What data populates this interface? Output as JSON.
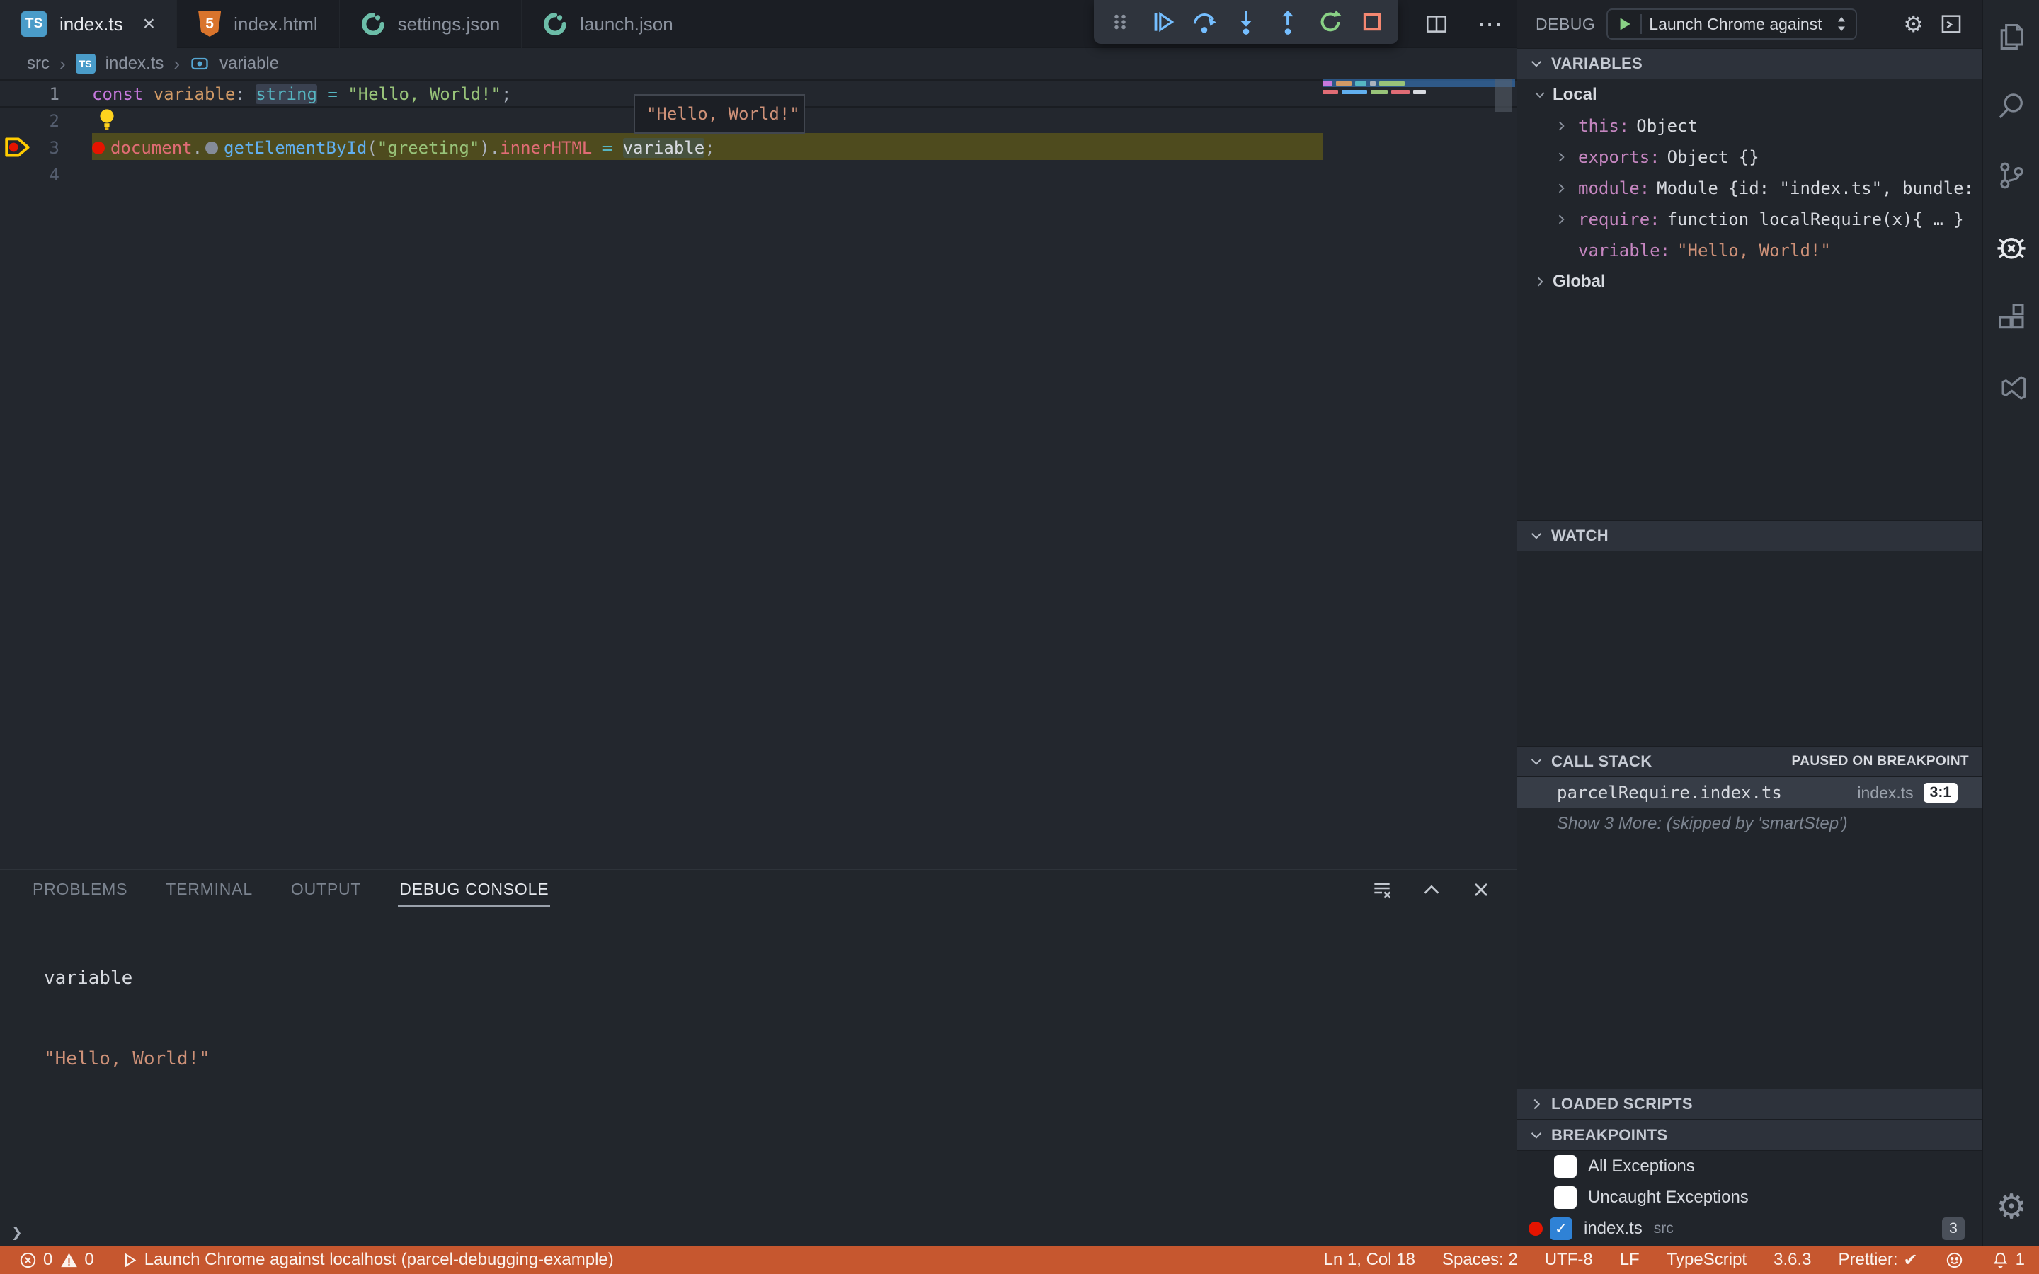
{
  "icons": {
    "ts_text": "TS",
    "html_digit": "5",
    "gear": "⚙",
    "more": "⋯",
    "check": "✓"
  },
  "tabs": {
    "close_label": "×",
    "items": [
      {
        "label": "index.ts",
        "icon": "typescript",
        "active": true
      },
      {
        "label": "index.html",
        "icon": "html5",
        "active": false
      },
      {
        "label": "settings.json",
        "icon": "json",
        "active": false
      },
      {
        "label": "launch.json",
        "icon": "json",
        "active": false
      }
    ]
  },
  "debug_toolbar": {
    "actions": [
      "drag-handle",
      "continue",
      "step-over",
      "step-into",
      "step-out",
      "restart",
      "stop"
    ]
  },
  "debug_panel_header": {
    "title": "DEBUG",
    "configuration": "Launch Chrome against local"
  },
  "breadcrumb": {
    "separator": "›",
    "items": [
      "src",
      "index.ts",
      "variable"
    ]
  },
  "editor": {
    "line_numbers": [
      "1",
      "2",
      "3",
      "4"
    ],
    "line1": [
      "const",
      " ",
      "variable",
      ":",
      " ",
      "string",
      " ",
      "=",
      " ",
      "\"Hello, World!\"",
      ";"
    ],
    "line3": [
      "document",
      ".",
      "getElementById",
      "(",
      "\"greeting\"",
      ")",
      ".",
      "innerHTML",
      " ",
      "=",
      " ",
      "variable",
      ";"
    ],
    "hover_tooltip": "\"Hello, World!\""
  },
  "variables": {
    "title": "VARIABLES",
    "scopes": [
      {
        "name": "Local",
        "expanded": true,
        "items": [
          {
            "name": "this",
            "sep": ":",
            "value": "Object"
          },
          {
            "name": "exports",
            "sep": ":",
            "value": "Object {}"
          },
          {
            "name": "module",
            "sep": ":",
            "value": "Module {id: \"index.ts\", bundle: , …"
          },
          {
            "name": "require",
            "sep": ":",
            "value": "function localRequire(x){ … }"
          },
          {
            "name": "variable",
            "sep": ":",
            "value": "\"Hello, World!\""
          }
        ]
      },
      {
        "name": "Global",
        "expanded": false
      }
    ]
  },
  "watch": {
    "title": "WATCH"
  },
  "call_stack": {
    "title": "CALL STACK",
    "status": "PAUSED ON BREAKPOINT",
    "frames": [
      {
        "name": "parcelRequire.index.ts",
        "file": "index.ts",
        "position": "3:1"
      }
    ],
    "more": "Show 3 More: (skipped by 'smartStep')"
  },
  "loaded_scripts": {
    "title": "LOADED SCRIPTS"
  },
  "breakpoints": {
    "title": "BREAKPOINTS",
    "items": [
      {
        "label": "All Exceptions",
        "checked": false
      },
      {
        "label": "Uncaught Exceptions",
        "checked": false
      },
      {
        "label": "index.ts",
        "detail": "src",
        "checked": true,
        "badge": "3"
      }
    ]
  },
  "panel": {
    "tabs": [
      "PROBLEMS",
      "TERMINAL",
      "OUTPUT",
      "DEBUG CONSOLE"
    ],
    "active_tab": "DEBUG CONSOLE",
    "output": [
      {
        "text": "variable",
        "kind": "plain"
      },
      {
        "text": "\"Hello, World!\"",
        "kind": "string"
      }
    ],
    "prompt": "❯"
  },
  "status_bar": {
    "errors": "0",
    "warnings": "0",
    "launch": "Launch Chrome against localhost (parcel-debugging-example)",
    "line_col": "Ln 1, Col 18",
    "spaces": "Spaces: 2",
    "encoding": "UTF-8",
    "eol": "LF",
    "language": "TypeScript",
    "version": "3.6.3",
    "formatter": "Prettier:",
    "formatter_check": "✔",
    "notifications": "1"
  },
  "colors": {
    "status_bar": "#C6572F",
    "breakpoint_red": "#E51400",
    "debug_blue": "#75BEFF",
    "restart_green": "#89D185",
    "stop_red": "#F48771",
    "string_orange": "#CE9178",
    "variable_pink": "#C586C0",
    "line_highlight": "#4E4B1E"
  }
}
